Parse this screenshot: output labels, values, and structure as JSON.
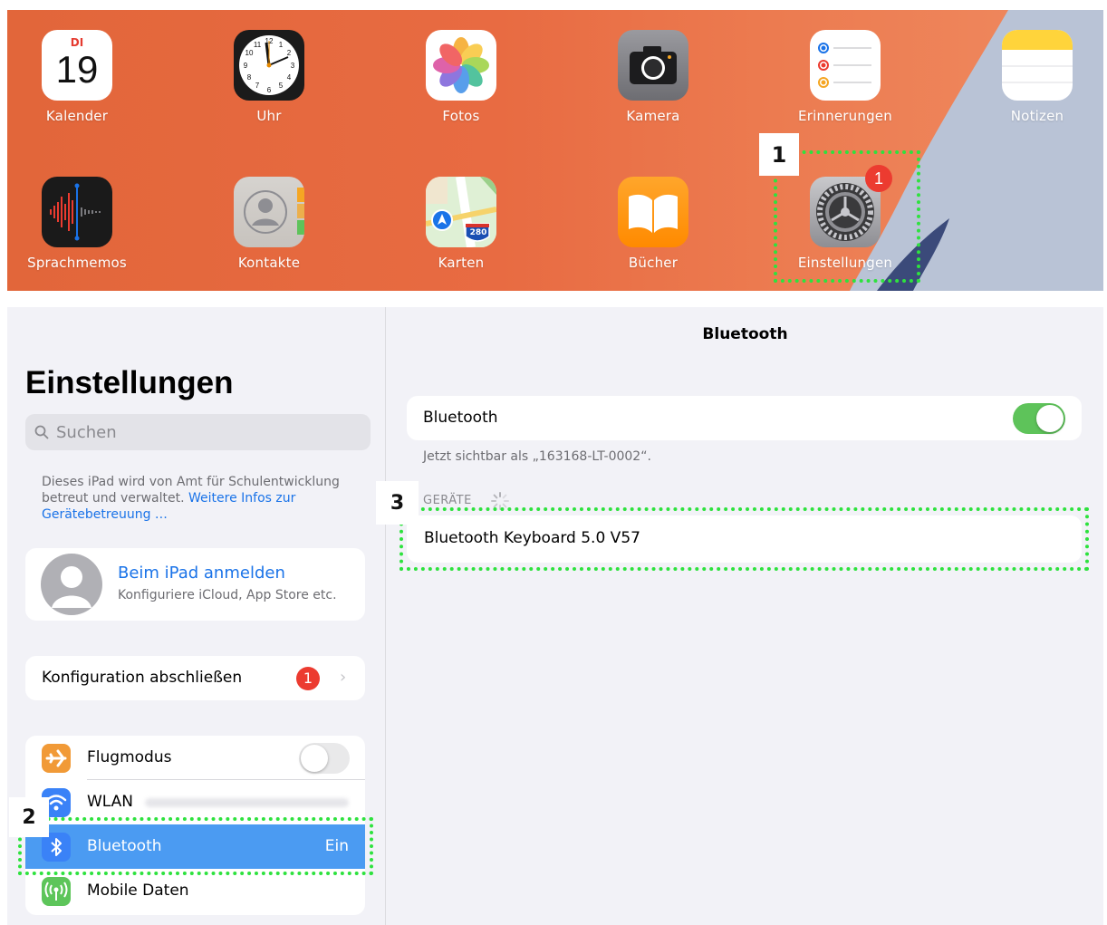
{
  "home": {
    "calendar": {
      "label": "Kalender",
      "weekday": "DI",
      "day": "19"
    },
    "apps": {
      "clock": "Uhr",
      "photos": "Fotos",
      "camera": "Kamera",
      "reminders": "Erinnerungen",
      "notes": "Notizen",
      "voice_memos": "Sprachmemos",
      "contacts": "Kontakte",
      "maps": "Karten",
      "books": "Bücher",
      "settings": "Einstellungen"
    },
    "settings_badge": "1",
    "maps_shield": "280"
  },
  "callouts": [
    "1",
    "2",
    "3"
  ],
  "sidebar": {
    "title": "Einstellungen",
    "search_placeholder": "Suchen",
    "managed_note": "Dieses iPad wird von Amt für Schulentwicklung betreut und verwaltet.",
    "managed_link": "Weitere Infos zur Gerätebetreuung …",
    "profile": {
      "title": "Beim iPad anmelden",
      "subtitle": "Konfiguriere iCloud, App Store etc."
    },
    "config": {
      "label": "Konfiguration abschließen",
      "badge": "1"
    },
    "rows": [
      {
        "label": "Flugmodus",
        "icon": "airplane-icon",
        "color": "#f19a37"
      },
      {
        "label": "WLAN",
        "icon": "wifi-icon",
        "color": "#3a82f7"
      },
      {
        "label": "Bluetooth",
        "value": "Ein",
        "icon": "bluetooth-icon",
        "color": "#3a82f7"
      },
      {
        "label": "Mobile Daten",
        "icon": "antenna-icon",
        "color": "#5dc55a"
      }
    ]
  },
  "detail": {
    "nav_title": "Bluetooth",
    "toggle_label": "Bluetooth",
    "visible_as": "Jetzt sichtbar als „163168-LT-0002“.",
    "devices_header": "GERÄTE",
    "device": "Bluetooth Keyboard 5.0 V57"
  },
  "colors": {
    "accent": "#1a73e8",
    "selection": "#4b9bf2",
    "toggle_on": "#5ec35a",
    "badge": "#ec3b30",
    "highlight": "#2ee23e",
    "wallpaper": "#e2663a"
  }
}
